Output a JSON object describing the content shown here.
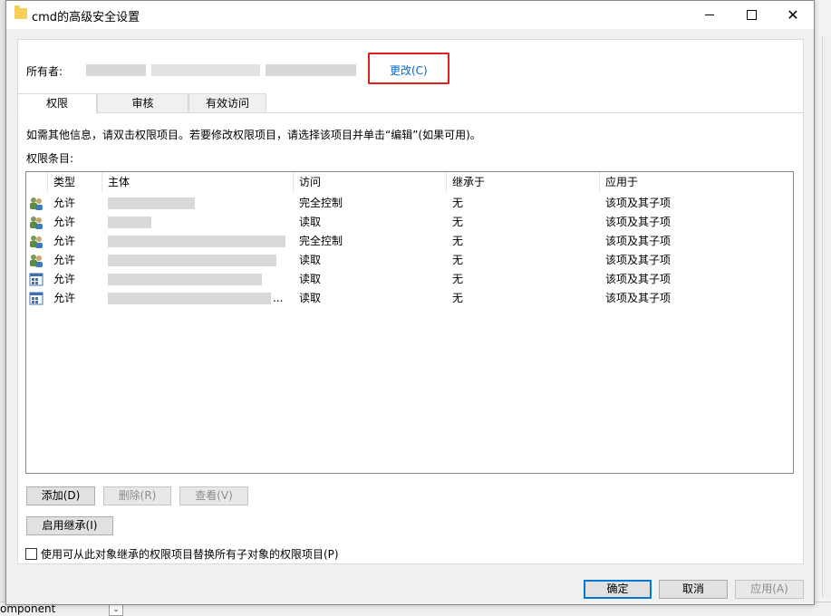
{
  "dialog": {
    "title": "cmd的高级安全设置",
    "owner_label": "所有者:",
    "owner_change_link": "更改(C)",
    "tabs": [
      {
        "label": "权限",
        "active": true
      },
      {
        "label": "审核",
        "active": false
      },
      {
        "label": "有效访问",
        "active": false
      }
    ],
    "info_text": "如需其他信息，请双击权限项目。若要修改权限项目，请选择该项目并单击“编辑”(如果可用)。",
    "entries_label": "权限条目:",
    "columns": [
      "类型",
      "主体",
      "访问",
      "继承于",
      "应用于"
    ],
    "rows": [
      {
        "icon": "users-icon",
        "type": "允许",
        "principal": "",
        "access": "完全控制",
        "inherited": "无",
        "applies": "该项及其子项"
      },
      {
        "icon": "users-icon",
        "type": "允许",
        "principal": "",
        "access": "读取",
        "inherited": "无",
        "applies": "该项及其子项"
      },
      {
        "icon": "users-icon",
        "type": "允许",
        "principal": "",
        "access": "完全控制",
        "inherited": "无",
        "applies": "该项及其子项"
      },
      {
        "icon": "users-icon",
        "type": "允许",
        "principal": "",
        "access": "读取",
        "inherited": "无",
        "applies": "该项及其子项"
      },
      {
        "icon": "app-package-icon",
        "type": "允许",
        "principal": "",
        "access": "读取",
        "inherited": "无",
        "applies": "该项及其子项"
      },
      {
        "icon": "app-package-icon",
        "type": "允许",
        "principal": "...",
        "access": "读取",
        "inherited": "无",
        "applies": "该项及其子项"
      }
    ],
    "buttons": {
      "add": "添加(D)",
      "remove": "删除(R)",
      "view": "查看(V)",
      "enable_inheritance": "启用继承(I)",
      "ok": "确定",
      "cancel": "取消",
      "apply": "应用(A)"
    },
    "replace_checkbox_label": "使用可从此对象继承的权限项目替换所有子对象的权限项目(P)",
    "replace_checkbox_checked": false
  },
  "background": {
    "bottom_text": "omponent"
  },
  "colors": {
    "link": "#0066cc",
    "highlight_box": "#e02020",
    "default_button_border": "#0078d7"
  }
}
